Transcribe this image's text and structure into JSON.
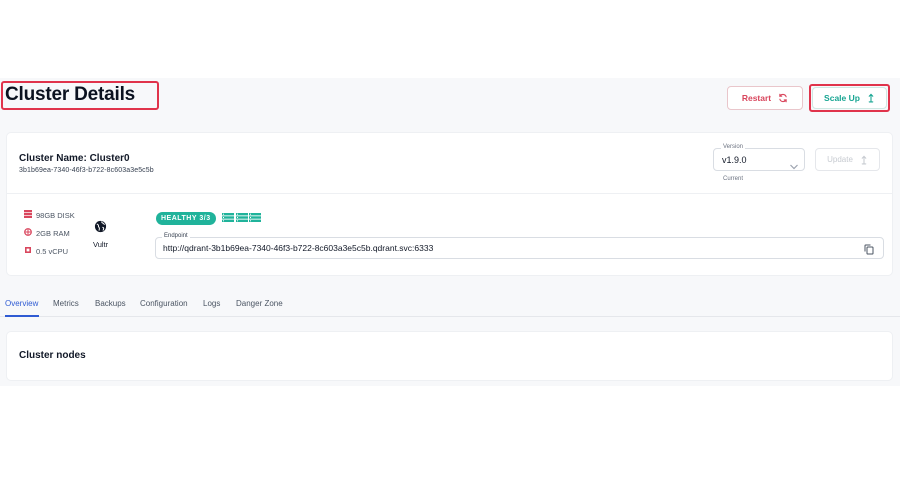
{
  "header": {
    "title": "Cluster Details",
    "restart_label": "Restart",
    "scale_up_label": "Scale Up"
  },
  "cluster": {
    "name": "Cluster Name: Cluster0",
    "id": "3b1b69ea-7340-46f3-b722-8c603a3e5c5b",
    "version_label": "Version",
    "version_value": "v1.9.0",
    "version_helper": "Current",
    "update_label": "Update",
    "specs": {
      "disk": "98GB DISK",
      "ram": "2GB RAM",
      "cpu": "0.5 vCPU"
    },
    "provider": "Vultr",
    "health_badge": "HEALTHY 3/3",
    "endpoint_label": "Endpoint",
    "endpoint_value": "http://qdrant-3b1b69ea-7340-46f3-b722-8c603a3e5c5b.qdrant.svc:6333"
  },
  "tabs": [
    "Overview",
    "Metrics",
    "Backups",
    "Configuration",
    "Logs",
    "Danger Zone"
  ],
  "active_tab": "Overview",
  "nodes_section": {
    "title": "Cluster nodes"
  },
  "colors": {
    "accent": "#2f5bd3",
    "danger": "#d9465d",
    "success": "#20b39b",
    "highlight": "#e0334b"
  },
  "icons": {
    "restart": "refresh-icon",
    "scale_up": "arrow-up-icon",
    "update": "arrow-up-icon",
    "disk": "database-icon",
    "ram": "memory-icon",
    "cpu": "cpu-icon",
    "provider": "globe-icon",
    "nodes": "server-stack-icon",
    "copy": "copy-icon"
  }
}
